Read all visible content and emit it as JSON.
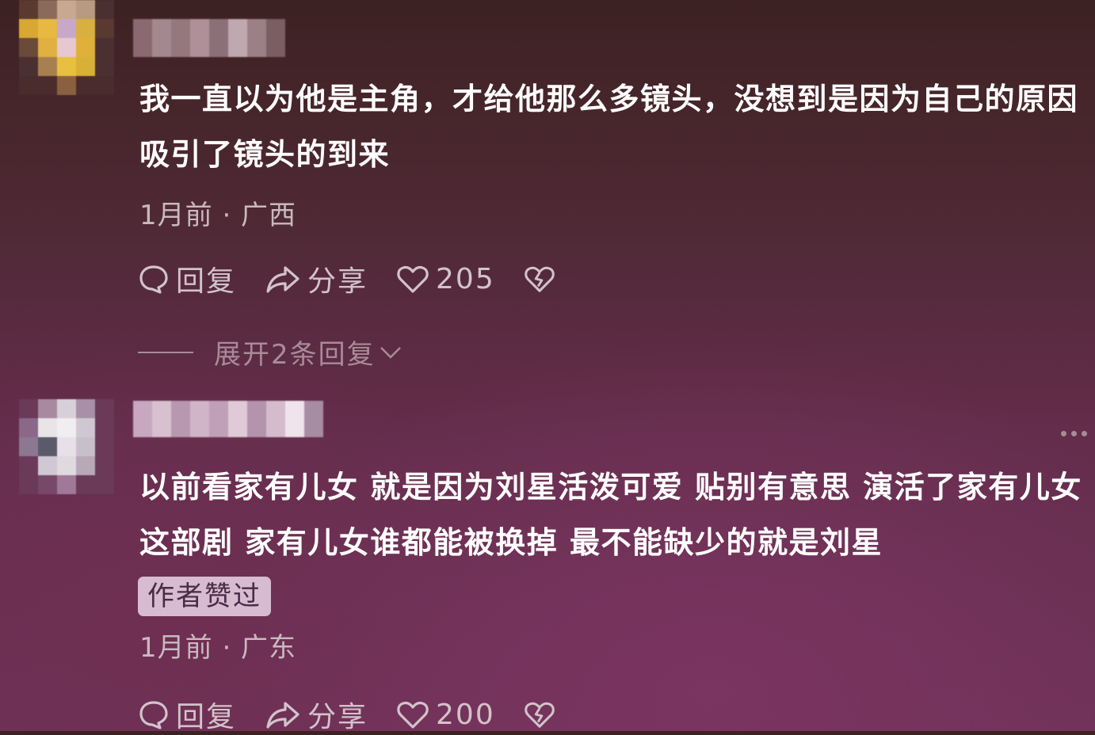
{
  "comments": [
    {
      "text": "我一直以为他是主角，才给他那么多镜头，没想到是因为自己的原因吸引了镜头的到来",
      "meta": "1月前 · 广西",
      "reply_label": "回复",
      "share_label": "分享",
      "like_count": "205",
      "expand_label": "展开2条回复"
    },
    {
      "text": "以前看家有儿女 就是因为刘星活泼可爱 贴别有意思 演活了家有儿女这部剧 家有儿女谁都能被换掉 最不能缺少的就是刘星",
      "badge": "作者赞过",
      "meta": "1月前 · 广东",
      "reply_label": "回复",
      "share_label": "分享",
      "like_count": "200"
    }
  ],
  "icons": [
    "reply-icon",
    "share-icon",
    "heart-icon",
    "dislike-icon",
    "chevron-down-icon",
    "more-icon"
  ],
  "colors": {
    "text": "#ffffff",
    "meta": "#c9b9c0",
    "badge_bg": "#d7bbd1",
    "background_top": "#3d2222",
    "background_bottom": "#6f3258"
  }
}
